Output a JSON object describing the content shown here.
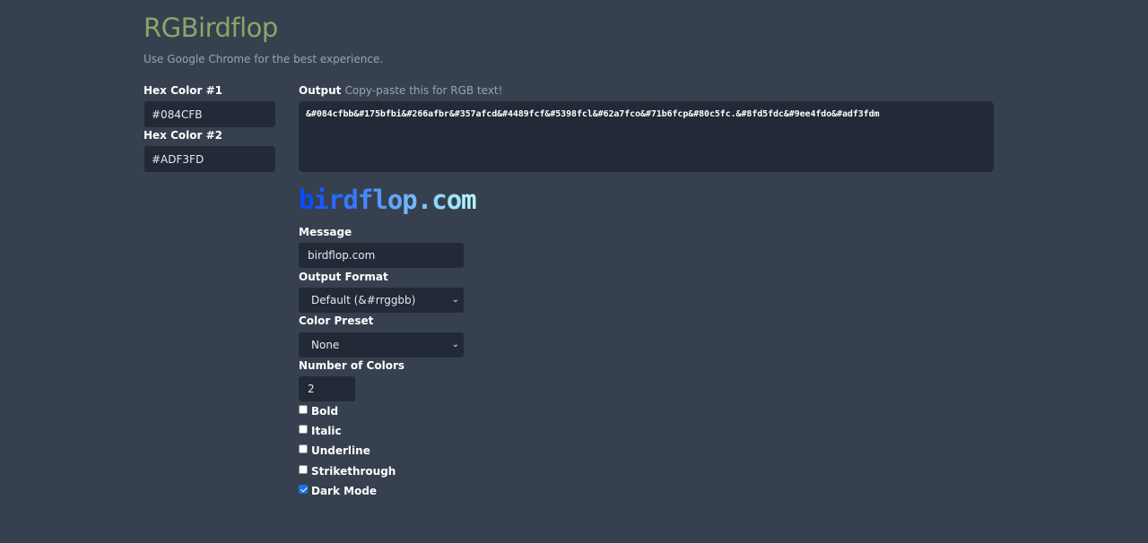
{
  "header": {
    "title": "RGBirdflop",
    "subtitle": "Use Google Chrome for the best experience."
  },
  "colors": {
    "label1": "Hex Color #1",
    "value1": "#084CFB",
    "swatch1": "#084CFB",
    "label2": "Hex Color #2",
    "value2": "#ADF3FD",
    "swatch2": "#ADF3FD"
  },
  "output": {
    "label": "Output",
    "hint": "Copy-paste this for RGB text!",
    "text": "&#084cfbb&#175bfbi&#266afbr&#357afcd&#4489fcf&#5398fcl&#62a7fco&#71b6fcp&#80c5fc.&#8fd5fdc&#9ee4fdo&#adf3fdm"
  },
  "preview": {
    "chars": [
      "b",
      "i",
      "r",
      "d",
      "f",
      "l",
      "o",
      "p",
      ".",
      "c",
      "o",
      "m"
    ],
    "colors": [
      "#084cfb",
      "#175bfb",
      "#266afb",
      "#357afc",
      "#4489fc",
      "#5398fc",
      "#62a7fc",
      "#71b6fc",
      "#80c5fc",
      "#8fd5fd",
      "#9ee4fd",
      "#adf3fd"
    ]
  },
  "message": {
    "label": "Message",
    "value": "birdflop.com"
  },
  "format": {
    "label": "Output Format",
    "selected": "Default (&#rrggbb)"
  },
  "preset": {
    "label": "Color Preset",
    "selected": "None"
  },
  "count": {
    "label": "Number of Colors",
    "value": "2"
  },
  "options": {
    "bold": "Bold",
    "italic": "Italic",
    "underline": "Underline",
    "strikethrough": "Strikethrough",
    "dark_mode": "Dark Mode"
  }
}
